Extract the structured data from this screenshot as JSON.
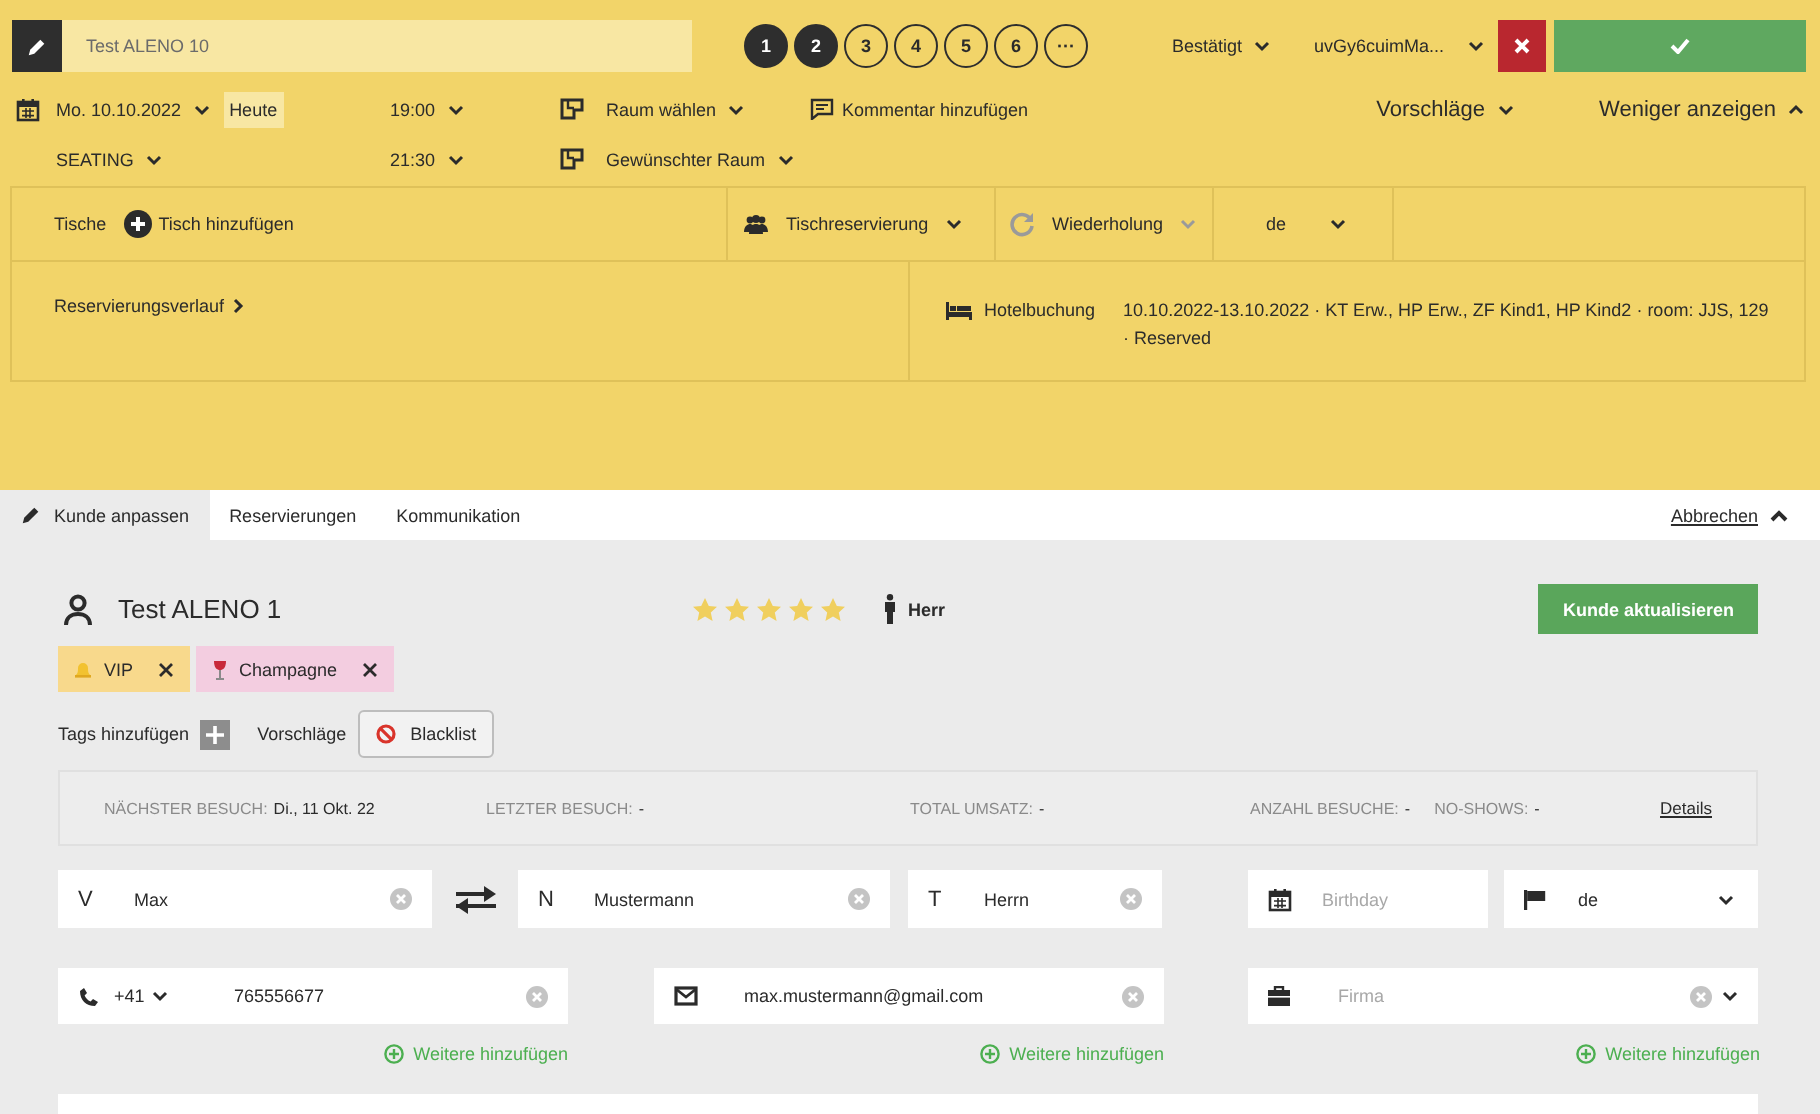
{
  "header": {
    "name": "Test ALENO 10",
    "party_sizes": [
      {
        "label": "1",
        "filled": true
      },
      {
        "label": "2",
        "filled": true
      },
      {
        "label": "3",
        "filled": false
      },
      {
        "label": "4",
        "filled": false
      },
      {
        "label": "5",
        "filled": false
      },
      {
        "label": "6",
        "filled": false
      },
      {
        "label": "···",
        "filled": false
      }
    ],
    "status": "Bestätigt",
    "user": "uvGy6cuimMa..."
  },
  "details": {
    "date": "Mo. 10.10.2022",
    "today": "Heute",
    "start_time": "19:00",
    "end_time": "21:30",
    "room": "Raum wählen",
    "wished_room": "Gewünschter Raum",
    "comment": "Kommentar hinzufügen",
    "area": "SEATING",
    "suggestions": "Vorschläge",
    "toggle": "Weniger anzeigen"
  },
  "reservation_box": {
    "tables_label": "Tische",
    "add_table": "Tisch hinzufügen",
    "reservation_type": "Tischreservierung",
    "repeat": "Wiederholung",
    "language": "de",
    "history": "Reservierungsverlauf",
    "hotel_label": "Hotelbuchung",
    "hotel_info": "10.10.2022-13.10.2022 · KT Erw., HP Erw., ZF Kind1, HP Kind2 · room: JJS, 129 · Reserved"
  },
  "tabs": [
    {
      "label": "Kunde anpassen",
      "selected": true,
      "kind": "edit"
    },
    {
      "label": "Reservierungen",
      "selected": false,
      "kind": "plain"
    },
    {
      "label": "Kommunikation",
      "selected": false,
      "kind": "plain"
    }
  ],
  "cancel": "Abbrechen",
  "customer": {
    "name": "Test ALENO 1",
    "stars": 5,
    "salutation": "Herr",
    "update_button": "Kunde aktualisieren",
    "tags": [
      {
        "label": "VIP",
        "color": "#f8d98c",
        "kind": "bell"
      },
      {
        "label": "Champagne",
        "color": "#f3cde0",
        "kind": "wine"
      }
    ],
    "add_tags": "Tags hinzufügen",
    "suggestions": "Vorschläge",
    "blacklist": "Blacklist",
    "stats": [
      {
        "label": "NÄCHSTER BESUCH:",
        "value": "Di., 11 Okt. 22"
      },
      {
        "label": "LETZTER BESUCH:",
        "value": "-"
      },
      {
        "label": "TOTAL UMSATZ:",
        "value": "-"
      },
      {
        "label": "ANZAHL BESUCHE:",
        "value": "-"
      },
      {
        "label": "NO-SHOWS:",
        "value": "-"
      }
    ],
    "details_link": "Details",
    "first_name": {
      "prefix": "V",
      "value": "Max"
    },
    "last_name": {
      "prefix": "N",
      "value": "Mustermann"
    },
    "title": {
      "prefix": "T",
      "value": "Herrn"
    },
    "birthday": {
      "placeholder": "Birthday"
    },
    "language": {
      "value": "de"
    },
    "phone": {
      "code": "+41",
      "value": "765556677"
    },
    "email": {
      "value": "max.mustermann@gmail.com"
    },
    "company": {
      "placeholder": "Firma"
    },
    "add_more": [
      "Weitere hinzufügen",
      "Weitere hinzufügen",
      "Weitere hinzufügen"
    ]
  }
}
